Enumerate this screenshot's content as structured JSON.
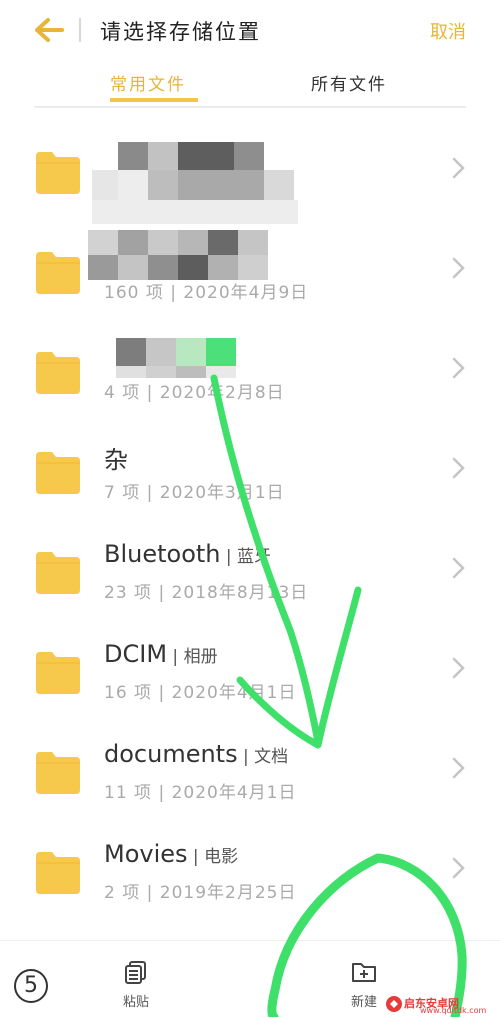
{
  "header": {
    "title": "请选择存储位置",
    "cancel_label": "取消"
  },
  "tabs": [
    {
      "label": "常用文件"
    },
    {
      "label": "所有文件"
    }
  ],
  "folders": [
    {
      "name": "",
      "meta": ""
    },
    {
      "name": "",
      "meta": "160 项 | 2020年4月9日"
    },
    {
      "name": "",
      "meta": "4 项 | 2020年2月8日"
    },
    {
      "name": "杂",
      "meta": "7 项 | 2020年3月1日"
    },
    {
      "name": "Bluetooth",
      "name_sub": " | 蓝牙",
      "meta": "23 项 | 2018年8月13日"
    },
    {
      "name": "DCIM",
      "name_sub": " | 相册",
      "meta": "16 项 | 2020年4月1日"
    },
    {
      "name": "documents",
      "name_sub": " | 文档",
      "meta": "11 项 | 2020年4月1日"
    },
    {
      "name": "Movies",
      "name_sub": " | 电影",
      "meta": "2 项 | 2019年2月25日"
    }
  ],
  "bottom": {
    "step_number": "5",
    "paste_label": "粘贴",
    "new_label": "新建"
  },
  "colors": {
    "accent": "#e8b535",
    "folder": "#f6c84c",
    "annotation": "#3fe06a"
  },
  "watermark": {
    "text": "启东安卓网",
    "url": "www.qdltdk.com"
  }
}
